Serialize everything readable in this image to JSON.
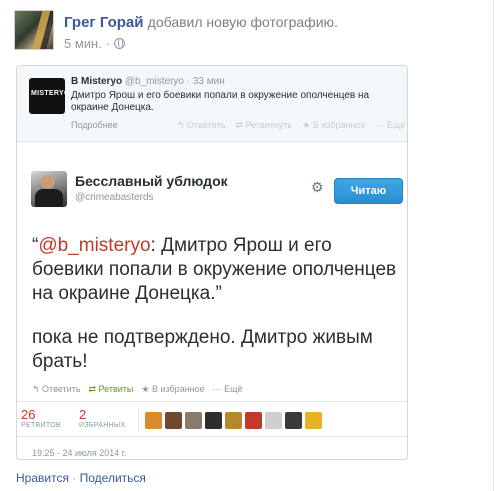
{
  "post": {
    "author": "Грег Горай",
    "action": "добавил новую фотографию.",
    "time": "5 мин.",
    "dot": "·"
  },
  "quoted_tweet": {
    "avatar_logo": "MISTERYO",
    "name": "В Misteryo",
    "handle": "@b_misteryo · 33 мин",
    "text": "Дмитро Ярош и его боевики попали в окружение ополченцев на окраине Донецка.",
    "more": "Подробнее",
    "actions": [
      "↰ Ответить",
      "⇄ Ретвитнуть",
      "★ В избранное",
      "··· Еще"
    ]
  },
  "tweet": {
    "name": "Бесславный ублюдок",
    "handle": "@crimeabasterds",
    "follow_label": "Читаю",
    "open_quote": "“",
    "mention": "@b_misteryo",
    "line1_rest": ": Дмитро Ярош и его",
    "line2": "боевики попали в окружение ополченцев",
    "line3": "на окраине Донецка.”",
    "line4": "пока не подтверждено. Дмитро живым",
    "line5": "брать!",
    "actions": {
      "reply": "↰ Ответить",
      "retweet": "⇄ Ретвиты",
      "favorite": "★ В избранное",
      "more": "··· Ещё"
    },
    "retweets_count": "26",
    "retweets_label": "РЕТВИТОВ",
    "favorites_count": "2",
    "favorites_label": "ИЗБРАННЫХ",
    "date": "19:25 - 24 июля 2014 г."
  },
  "fb_actions": {
    "like": "Нравится",
    "separator": " · ",
    "share": "Поделиться"
  },
  "fav_avatar_colors": [
    "#d98a2b",
    "#6d4a2f",
    "#8a7a6a",
    "#2e2e2e",
    "#b5872f",
    "#c0392b",
    "#cfcfcf",
    "#3a3a3a",
    "#e6b325"
  ]
}
